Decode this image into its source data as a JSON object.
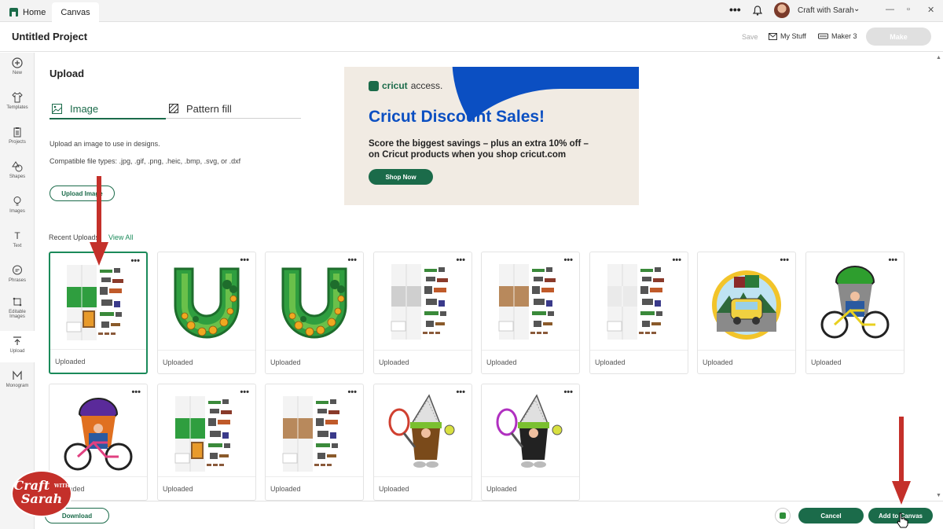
{
  "tabs": {
    "home": "Home",
    "canvas": "Canvas"
  },
  "account": {
    "user": "Craft with Sarah"
  },
  "header": {
    "project_title": "Untitled Project",
    "save": "Save",
    "my_stuff": "My Stuff",
    "machine": "Maker 3",
    "make": "Make"
  },
  "sidebar": {
    "items": [
      {
        "label": "New",
        "icon": "plus-circle-icon"
      },
      {
        "label": "Templates",
        "icon": "tshirt-icon"
      },
      {
        "label": "Projects",
        "icon": "clipboard-icon"
      },
      {
        "label": "Shapes",
        "icon": "shapes-icon"
      },
      {
        "label": "Images",
        "icon": "lightbulb-icon"
      },
      {
        "label": "Text",
        "icon": "text-icon"
      },
      {
        "label": "Phrases",
        "icon": "speech-bubble-icon"
      },
      {
        "label": "Editable Images",
        "icon": "editable-image-icon"
      },
      {
        "label": "Upload",
        "icon": "upload-icon",
        "active": true
      },
      {
        "label": "Monogram",
        "icon": "monogram-icon"
      }
    ]
  },
  "upload": {
    "title": "Upload",
    "tab_image": "Image",
    "tab_pattern": "Pattern fill",
    "description": "Upload an image to use in designs.",
    "file_types": "Compatible file types: .jpg, .gif, .png, .heic, .bmp, .svg, or .dxf",
    "upload_button": "Upload Image",
    "recent_label": "Recent Uploads",
    "view_all": "View All"
  },
  "ad": {
    "brand_bold": "cricut",
    "brand_light": "access.",
    "headline": "Cricut Discount Sales!",
    "line1": "Score the biggest savings – plus an extra 10% off –",
    "line2": "on Cricut products when you shop cricut.com",
    "button": "Shop Now"
  },
  "uploads": [
    {
      "label": "Uploaded",
      "kind": "sheet-green",
      "selected": true
    },
    {
      "label": "Uploaded",
      "kind": "horseshoe"
    },
    {
      "label": "Uploaded",
      "kind": "horseshoe"
    },
    {
      "label": "Uploaded",
      "kind": "sheet-gray"
    },
    {
      "label": "Uploaded",
      "kind": "sheet-brown"
    },
    {
      "label": "Uploaded",
      "kind": "sheet-light"
    },
    {
      "label": "Uploaded",
      "kind": "car-circle"
    },
    {
      "label": "Uploaded",
      "kind": "gnome-bike-green"
    },
    {
      "label": "Uploaded",
      "kind": "gnome-bike-purple"
    },
    {
      "label": "Uploaded",
      "kind": "sheet-green"
    },
    {
      "label": "Uploaded",
      "kind": "sheet-brown"
    },
    {
      "label": "Uploaded",
      "kind": "gnome-tennis-brown"
    },
    {
      "label": "Uploaded",
      "kind": "gnome-tennis-black"
    }
  ],
  "footer": {
    "download": "Download",
    "cancel": "Cancel",
    "add_to_canvas": "Add to Canvas"
  },
  "watermark": {
    "line1": "Craft",
    "with": "WITH",
    "line2": "Sarah"
  },
  "colors": {
    "brand_green": "#1b6b4a",
    "accent_blue": "#0b4fc2",
    "arrow_red": "#c4302a"
  }
}
